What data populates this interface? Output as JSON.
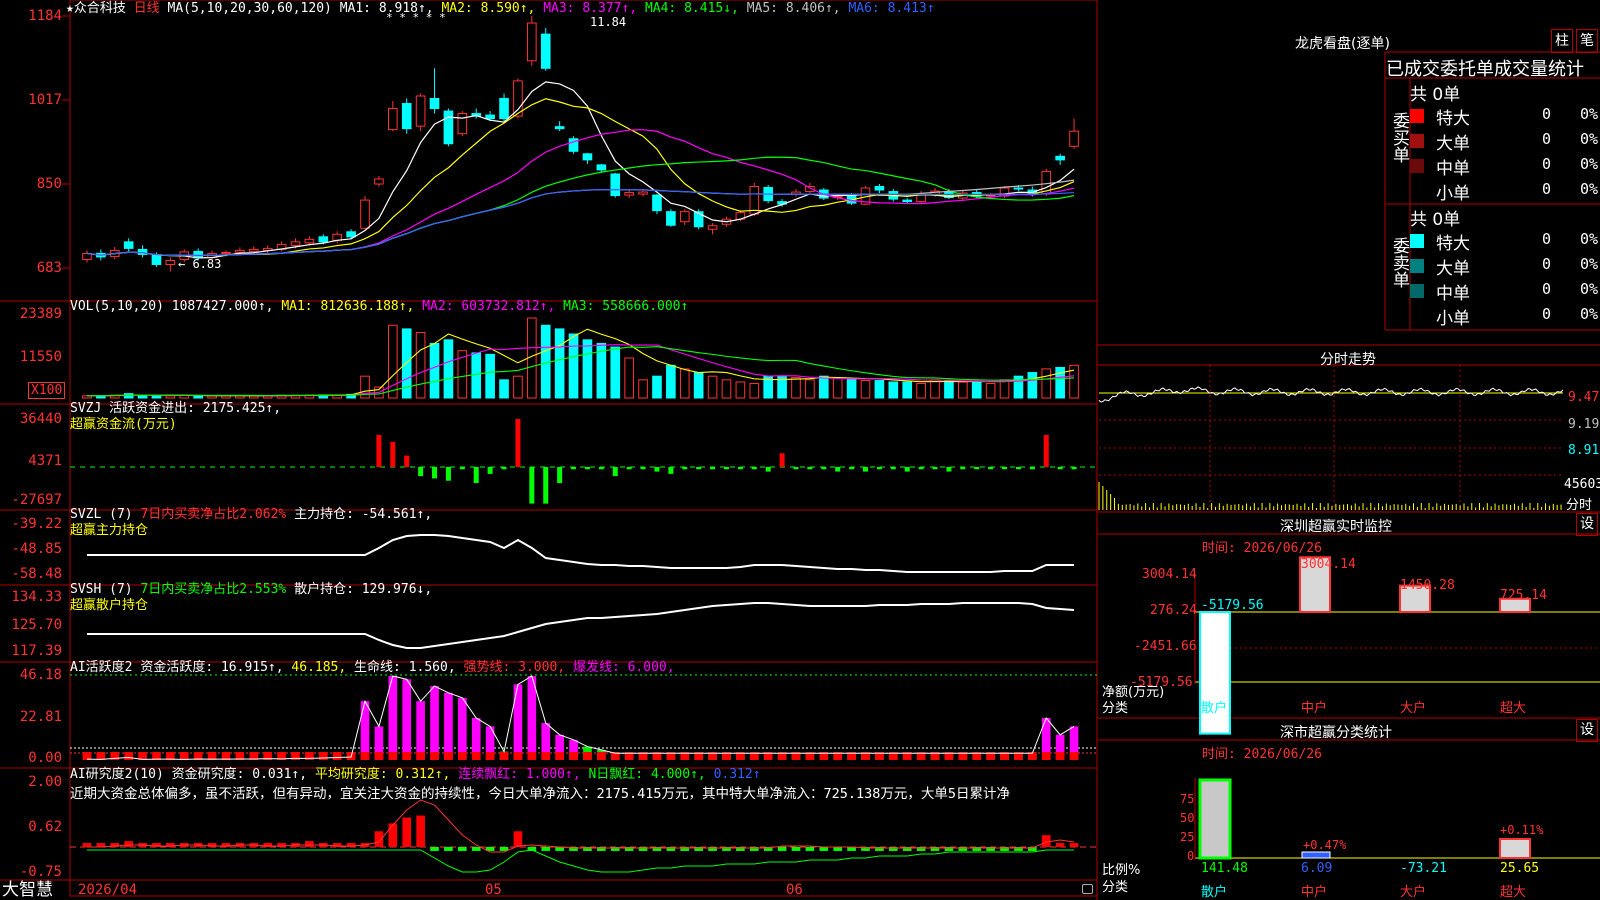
{
  "app": {
    "name": "大智慧"
  },
  "stock": {
    "name": "★众合科技",
    "period": "日线"
  },
  "colors": {
    "up": "#ff3232",
    "down": "#00ffff",
    "ma1": "#ffffff",
    "ma2": "#ffff00",
    "ma3": "#ff00ff",
    "ma4": "#00ff00",
    "ma5": "#c0c0c0",
    "ma6": "#3060ff",
    "grid": "#b00000"
  },
  "main_header": {
    "ma_params": "MA(5,10,20,30,60,120)",
    "ma1": "MA1: 8.918↑,",
    "ma2": "MA2: 8.590↑,",
    "ma3": "MA3: 8.377↑,",
    "ma4": "MA4: 8.415↓,",
    "ma5": "MA5: 8.406↑,",
    "ma6": "MA6: 8.413↑"
  },
  "main_axis": [
    "1184",
    "1017",
    "850",
    "683"
  ],
  "main_marks": {
    "high_label": "11.84",
    "low_label": "← 6.83",
    "stars": "*   *   *   *   *"
  },
  "vol_header": {
    "name": "VOL(5,10,20)",
    "vol": "1087427.000↑,",
    "ma1": "MA1: 812636.188↑,",
    "ma2": "MA2: 603732.812↑,",
    "ma3": "MA3: 558666.000↑"
  },
  "vol_axis": [
    "23389",
    "11550"
  ],
  "vol_unit": "X100",
  "svzj_header": {
    "name": "SVZJ",
    "label": "活跃资金进出: 2175.425↑,",
    "sub": "超赢资金流(万元)"
  },
  "svzj_axis": [
    "36440",
    "4371",
    "-27697"
  ],
  "svzl_header": {
    "name": "SVZL  (7)",
    "label": "7日内买卖净占比2.062%",
    "value": "主力持仓: -54.561↑,",
    "sub": "超赢主力持仓"
  },
  "svzl_axis": [
    "-39.22",
    "-48.85",
    "-58.48"
  ],
  "svsh_header": {
    "name": "SVSH  (7)",
    "label": "7日内买卖净占比2.553%",
    "value": "散户持仓: 129.976↓,",
    "sub": "超赢散户持仓"
  },
  "svsh_axis": [
    "134.33",
    "125.70",
    "117.39"
  ],
  "ai_act_header": {
    "name": "AI活跃度2",
    "label": "资金活跃度: 16.915↑,",
    "v2": "46.185,",
    "life": "生命线: 1.560,",
    "strong": "强势线: 3.000,",
    "burst": "爆发线: 6.000,"
  },
  "ai_act_axis": [
    "46.18",
    "22.81",
    "0.00"
  ],
  "ai_res_header": {
    "name": "AI研究度2(10)",
    "label": "资金研究度: 0.031↑,",
    "avg": "平均研究度: 0.312↑,",
    "streak": "连续飘红: 1.000↑,",
    "nday": "N日飘红: 4.000↑,",
    "last": "0.312↑"
  },
  "ai_res_text": "近期大资金总体偏多，虽不活跃，但有异动，宜关注大资金的持续性，今日大单净流入：2175.415万元，其中特大单净流入：725.138万元，大单5日累计净",
  "ai_res_axis": [
    "2.00",
    "0.62",
    "-0.75"
  ],
  "date_axis": {
    "d1": "2026/04",
    "d2": "05",
    "d3": "06"
  },
  "lhb": {
    "title": "龙虎看盘(逐单)",
    "btn1": "柱",
    "btn2": "笔",
    "heading": "已成交委托单成交量统计",
    "buy": {
      "side": "委买单",
      "total": "共 0单",
      "rows": [
        {
          "label": "特大",
          "v1": "0",
          "v2": "0%",
          "color": "#ff0000"
        },
        {
          "label": "大单",
          "v1": "0",
          "v2": "0%",
          "color": "#a01010"
        },
        {
          "label": "中单",
          "v1": "0",
          "v2": "0%",
          "color": "#6a0a0a"
        },
        {
          "label": "小单",
          "v1": "0",
          "v2": "0%",
          "color": ""
        }
      ]
    },
    "sell": {
      "side": "委卖单",
      "total": "共 0单",
      "rows": [
        {
          "label": "特大",
          "v1": "0",
          "v2": "0%",
          "color": "#00ffff"
        },
        {
          "label": "大单",
          "v1": "0",
          "v2": "0%",
          "color": "#008080"
        },
        {
          "label": "中单",
          "v1": "0",
          "v2": "0%",
          "color": "#006868"
        },
        {
          "label": "小单",
          "v1": "0",
          "v2": "0%",
          "color": ""
        }
      ]
    }
  },
  "minute": {
    "title": "分时走势",
    "axis": [
      "9.47",
      "9.19",
      "8.91"
    ],
    "vol_axis": "45603",
    "vol_label": "分时"
  },
  "sz_monitor": {
    "title": "深圳超赢实时监控",
    "settings": "设",
    "time": "时间: 2026/06/26",
    "axis": [
      "3004.14",
      "276.24",
      "-2451.66",
      "-5179.56"
    ],
    "net_label": "净额(万元)",
    "class_label": "分类",
    "categories": [
      "散户",
      "中户",
      "大户",
      "超大"
    ],
    "value_labels": [
      "-5179.56",
      "3004.14",
      "1450.28",
      "725.14"
    ],
    "values": [
      -5179.56,
      3004.14,
      1450.28,
      725.14
    ]
  },
  "sz_class": {
    "title": "深市超赢分类统计",
    "settings": "设",
    "time": "时间: 2026/06/26",
    "axis": [
      "75",
      "50",
      "25",
      "0"
    ],
    "ratio_label": "比例%",
    "class_label": "分类",
    "categories": [
      "散户",
      "中户",
      "大户",
      "超大"
    ],
    "bottom_values": [
      "141.48",
      "6.09",
      "-73.21",
      "25.65"
    ],
    "top_labels": [
      "",
      "+0.47%",
      "",
      "+0.11%"
    ]
  },
  "chart_data": {
    "type": "candlestick",
    "candles": [
      {
        "o": 700,
        "c": 712,
        "h": 718,
        "l": 694
      },
      {
        "o": 712,
        "c": 705,
        "h": 720,
        "l": 698
      },
      {
        "o": 706,
        "c": 718,
        "h": 725,
        "l": 700
      },
      {
        "o": 735,
        "c": 722,
        "h": 742,
        "l": 716
      },
      {
        "o": 720,
        "c": 710,
        "h": 728,
        "l": 704
      },
      {
        "o": 708,
        "c": 690,
        "h": 714,
        "l": 685
      },
      {
        "o": 690,
        "c": 698,
        "h": 704,
        "l": 676
      },
      {
        "o": 700,
        "c": 715,
        "h": 720,
        "l": 695
      },
      {
        "o": 716,
        "c": 703,
        "h": 722,
        "l": 698
      },
      {
        "o": 704,
        "c": 712,
        "h": 718,
        "l": 700
      },
      {
        "o": 712,
        "c": 714,
        "h": 718,
        "l": 706
      },
      {
        "o": 714,
        "c": 718,
        "h": 724,
        "l": 708
      },
      {
        "o": 716,
        "c": 720,
        "h": 726,
        "l": 710
      },
      {
        "o": 718,
        "c": 722,
        "h": 728,
        "l": 712
      },
      {
        "o": 720,
        "c": 730,
        "h": 736,
        "l": 716
      },
      {
        "o": 728,
        "c": 735,
        "h": 742,
        "l": 722
      },
      {
        "o": 733,
        "c": 740,
        "h": 746,
        "l": 728
      },
      {
        "o": 745,
        "c": 735,
        "h": 750,
        "l": 730
      },
      {
        "o": 738,
        "c": 750,
        "h": 756,
        "l": 732
      },
      {
        "o": 755,
        "c": 745,
        "h": 760,
        "l": 740
      },
      {
        "o": 762,
        "c": 818,
        "h": 826,
        "l": 760
      },
      {
        "o": 850,
        "c": 860,
        "h": 866,
        "l": 845
      },
      {
        "o": 958,
        "c": 1000,
        "h": 1015,
        "l": 955
      },
      {
        "o": 1010,
        "c": 960,
        "h": 1020,
        "l": 950
      },
      {
        "o": 965,
        "c": 1025,
        "h": 1030,
        "l": 955
      },
      {
        "o": 1020,
        "c": 1000,
        "h": 1080,
        "l": 990
      },
      {
        "o": 995,
        "c": 930,
        "h": 1000,
        "l": 925
      },
      {
        "o": 950,
        "c": 990,
        "h": 995,
        "l": 945
      },
      {
        "o": 990,
        "c": 985,
        "h": 1000,
        "l": 980
      },
      {
        "o": 987,
        "c": 980,
        "h": 995,
        "l": 975
      },
      {
        "o": 1020,
        "c": 980,
        "h": 1030,
        "l": 975
      },
      {
        "o": 985,
        "c": 1055,
        "h": 1060,
        "l": 980
      },
      {
        "o": 1095,
        "c": 1170,
        "h": 1184,
        "l": 1085
      },
      {
        "o": 1148,
        "c": 1080,
        "h": 1160,
        "l": 1075
      },
      {
        "o": 964,
        "c": 960,
        "h": 975,
        "l": 955
      },
      {
        "o": 940,
        "c": 915,
        "h": 945,
        "l": 910
      },
      {
        "o": 910,
        "c": 898,
        "h": 912,
        "l": 890
      },
      {
        "o": 888,
        "c": 878,
        "h": 890,
        "l": 872
      },
      {
        "o": 870,
        "c": 827,
        "h": 872,
        "l": 823
      },
      {
        "o": 828,
        "c": 833,
        "h": 838,
        "l": 822
      },
      {
        "o": 830,
        "c": 834,
        "h": 838,
        "l": 825
      },
      {
        "o": 828,
        "c": 797,
        "h": 830,
        "l": 790
      },
      {
        "o": 795,
        "c": 768,
        "h": 800,
        "l": 765
      },
      {
        "o": 775,
        "c": 795,
        "h": 800,
        "l": 768
      },
      {
        "o": 795,
        "c": 765,
        "h": 800,
        "l": 760
      },
      {
        "o": 760,
        "c": 767,
        "h": 772,
        "l": 750
      },
      {
        "o": 770,
        "c": 780,
        "h": 785,
        "l": 765
      },
      {
        "o": 780,
        "c": 793,
        "h": 798,
        "l": 776
      },
      {
        "o": 790,
        "c": 845,
        "h": 852,
        "l": 786
      },
      {
        "o": 843,
        "c": 817,
        "h": 848,
        "l": 812
      },
      {
        "o": 815,
        "c": 810,
        "h": 820,
        "l": 805
      },
      {
        "o": 830,
        "c": 834,
        "h": 840,
        "l": 825
      },
      {
        "o": 835,
        "c": 845,
        "h": 852,
        "l": 830
      },
      {
        "o": 838,
        "c": 822,
        "h": 842,
        "l": 818
      },
      {
        "o": 823,
        "c": 825,
        "h": 830,
        "l": 818
      },
      {
        "o": 828,
        "c": 812,
        "h": 832,
        "l": 808
      },
      {
        "o": 810,
        "c": 842,
        "h": 846,
        "l": 808
      },
      {
        "o": 845,
        "c": 838,
        "h": 850,
        "l": 832
      },
      {
        "o": 835,
        "c": 820,
        "h": 840,
        "l": 815
      },
      {
        "o": 818,
        "c": 815,
        "h": 822,
        "l": 810
      },
      {
        "o": 815,
        "c": 830,
        "h": 836,
        "l": 812
      },
      {
        "o": 828,
        "c": 836,
        "h": 842,
        "l": 824
      },
      {
        "o": 835,
        "c": 823,
        "h": 840,
        "l": 820
      },
      {
        "o": 822,
        "c": 832,
        "h": 836,
        "l": 818
      },
      {
        "o": 833,
        "c": 826,
        "h": 838,
        "l": 822
      },
      {
        "o": 826,
        "c": 828,
        "h": 832,
        "l": 822
      },
      {
        "o": 826,
        "c": 842,
        "h": 846,
        "l": 822
      },
      {
        "o": 842,
        "c": 840,
        "h": 848,
        "l": 836
      },
      {
        "o": 838,
        "c": 830,
        "h": 845,
        "l": 825
      },
      {
        "o": 830,
        "c": 875,
        "h": 880,
        "l": 826
      },
      {
        "o": 905,
        "c": 898,
        "h": 910,
        "l": 888
      },
      {
        "o": 925,
        "c": 955,
        "h": 980,
        "l": 920
      }
    ],
    "volume": [
      3,
      3,
      4,
      6,
      4,
      3,
      3,
      4,
      3,
      3,
      3,
      3,
      3,
      3,
      4,
      4,
      4,
      4,
      4,
      5,
      30,
      15,
      100,
      95,
      90,
      75,
      80,
      65,
      62,
      60,
      25,
      30,
      110,
      100,
      95,
      88,
      80,
      75,
      70,
      55,
      25,
      30,
      45,
      40,
      35,
      30,
      25,
      22,
      20,
      30,
      30,
      28,
      25,
      30,
      28,
      26,
      24,
      24,
      22,
      22,
      20,
      25,
      24,
      22,
      22,
      20,
      25,
      30,
      35,
      40,
      42,
      45
    ],
    "svzj": [
      0,
      0,
      0,
      0,
      0,
      0,
      0,
      0,
      0,
      0,
      0,
      0,
      0,
      0,
      0,
      0,
      0,
      0,
      0,
      0,
      0,
      28000,
      22000,
      10000,
      -8000,
      -10000,
      -12000,
      -2000,
      -14000,
      -6000,
      -2000,
      42000,
      -32000,
      -32000,
      -14000,
      -2000,
      -2000,
      -2000,
      -8000,
      -2000,
      -2000,
      -4000,
      -6000,
      -2000,
      -2000,
      -2000,
      -2000,
      -2000,
      -2000,
      -4000,
      12000,
      -2000,
      -2000,
      -2000,
      -4000,
      -2000,
      -4000,
      -2000,
      -2000,
      -4000,
      -2000,
      -2000,
      -4000,
      -2000,
      -2000,
      -2000,
      -2000,
      -2000,
      -2000,
      28000,
      -2000,
      -2000
    ],
    "ai_activity": [
      0.5,
      0.4,
      1.0,
      1.5,
      0.4,
      0.5,
      0.5,
      0.4,
      0.6,
      0.5,
      0.5,
      0.6,
      0.6,
      0.8,
      0.7,
      1.0,
      1.0,
      1.2,
      1.5,
      1.8,
      35,
      20,
      50,
      48,
      35,
      44,
      40,
      37,
      25,
      20,
      5,
      45,
      50,
      22,
      15,
      12,
      8,
      6,
      4,
      4,
      4,
      4,
      4,
      4,
      4,
      4,
      4,
      4,
      4,
      4,
      4,
      4,
      4,
      4,
      4,
      4,
      4,
      4,
      4,
      4,
      4,
      4,
      4,
      4,
      4,
      4,
      4,
      4,
      4,
      25,
      15,
      20
    ],
    "ai_research": [
      0.1,
      0.1,
      0.1,
      0.15,
      0.1,
      0.1,
      0.1,
      0.1,
      0.1,
      0.1,
      0.1,
      0.1,
      0.1,
      0.1,
      0.1,
      0.1,
      0.15,
      0.1,
      0.1,
      0.1,
      0.1,
      0.4,
      0.6,
      0.75,
      0.8,
      -0.1,
      -0.1,
      -0.1,
      -0.1,
      -0.1,
      -0.1,
      0.4,
      -0.1,
      -0.1,
      -0.1,
      -0.1,
      -0.1,
      -0.1,
      -0.1,
      -0.1,
      -0.1,
      -0.1,
      -0.1,
      -0.1,
      -0.1,
      -0.1,
      -0.1,
      -0.1,
      -0.1,
      -0.1,
      -0.1,
      -0.1,
      -0.1,
      -0.1,
      -0.1,
      -0.1,
      -0.1,
      -0.1,
      -0.1,
      -0.1,
      -0.1,
      -0.1,
      -0.1,
      -0.1,
      -0.1,
      -0.1,
      -0.1,
      -0.1,
      -0.1,
      0.3,
      0.1,
      0.1
    ],
    "series": [
      {
        "name": "MA1",
        "color": "#ffffff"
      },
      {
        "name": "MA2",
        "color": "#ffff00"
      },
      {
        "name": "MA3",
        "color": "#ff00ff"
      },
      {
        "name": "MA4",
        "color": "#00ff00"
      },
      {
        "name": "MA5",
        "color": "#c0c0c0"
      },
      {
        "name": "MA6",
        "color": "#3060ff"
      }
    ],
    "ylim": [
      683,
      1184
    ]
  }
}
